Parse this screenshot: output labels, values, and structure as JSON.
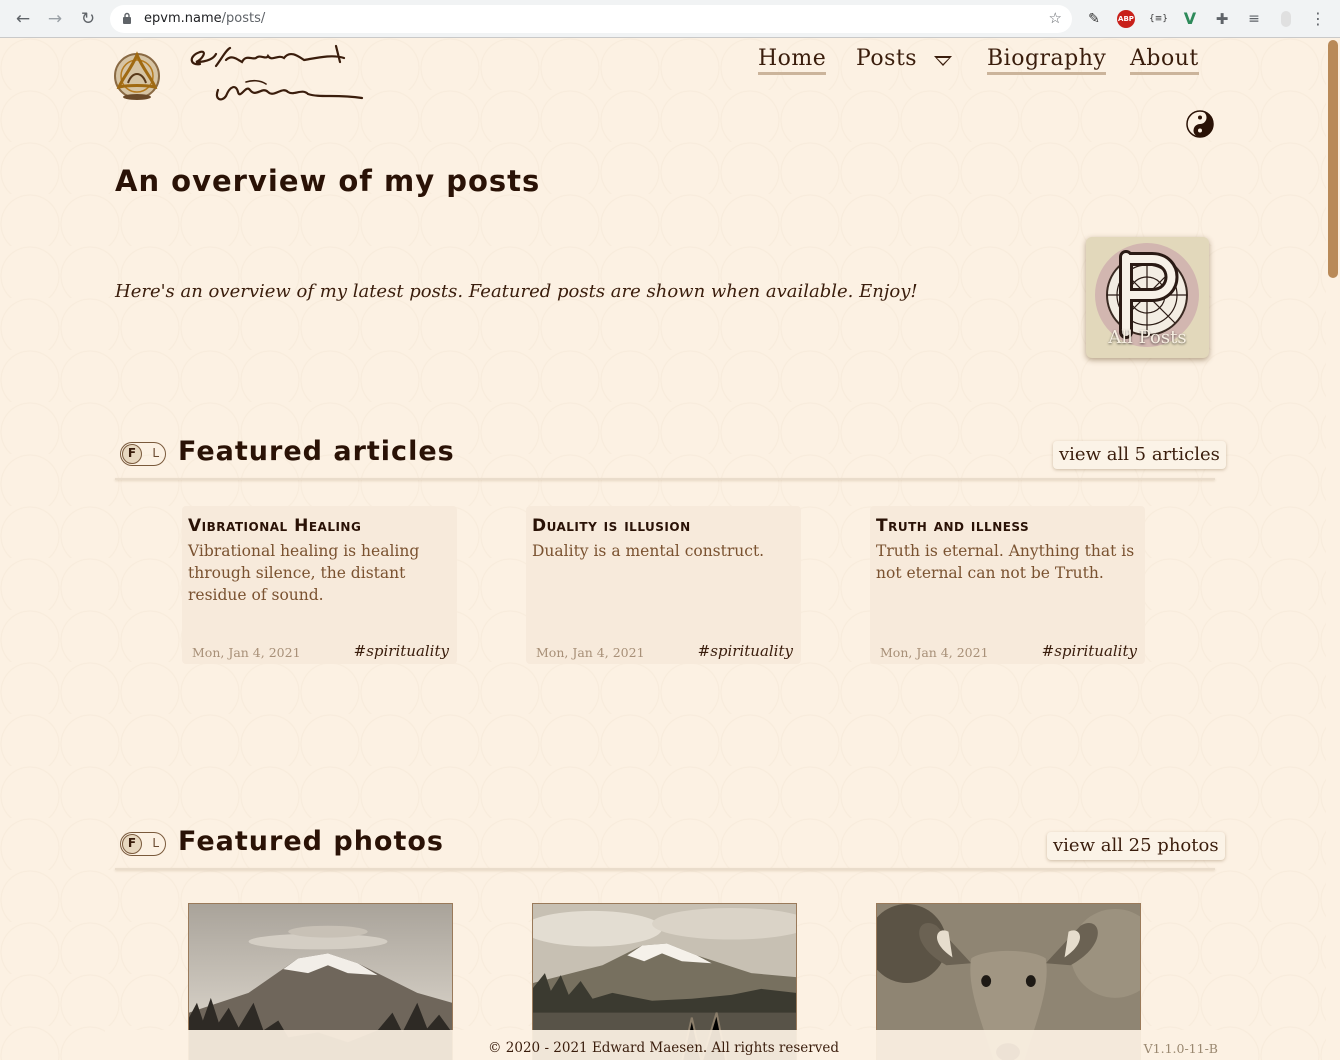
{
  "browser": {
    "url_host": "epvm.name",
    "url_path": "/posts/",
    "extensions": [
      "ABP",
      "{≡}"
    ]
  },
  "site": {
    "signature_text": "Edward Maesen",
    "nav": {
      "home": "Home",
      "posts": "Posts",
      "biography": "Biography",
      "about": "About"
    }
  },
  "main": {
    "title": "An overview of my posts",
    "intro": "Here's an overview of my latest posts. Featured posts are shown when available. Enjoy!",
    "all_posts_label": "All Posts"
  },
  "articles": {
    "toggle_on": "F",
    "toggle_off": "L",
    "title": "Featured articles",
    "view_all": "view all 5 articles",
    "cards": [
      {
        "title": "Vibrational Healing",
        "desc": "Vibrational healing is healing through silence, the distant residue of sound.",
        "date": "Mon, Jan 4, 2021",
        "tag": "#spirituality"
      },
      {
        "title": "Duality is illusion",
        "desc": "Duality is a mental construct.",
        "date": "Mon, Jan 4, 2021",
        "tag": "#spirituality"
      },
      {
        "title": "Truth and illness",
        "desc": "Truth is eternal. Anything that is not eternal can not be Truth.",
        "date": "Mon, Jan 4, 2021",
        "tag": "#spirituality"
      }
    ]
  },
  "photos": {
    "toggle_on": "F",
    "toggle_off": "L",
    "title": "Featured photos",
    "view_all": "view all 25 photos"
  },
  "footer": {
    "copyright": "© 2020 - 2021 Edward Maesen. All rights reserved",
    "version": "V1.1.0-11-B"
  },
  "colors": {
    "background": "#fcf1e3",
    "text_dark": "#2a1206",
    "accent_brown": "#7a5230",
    "underline": "#cbb49b"
  }
}
